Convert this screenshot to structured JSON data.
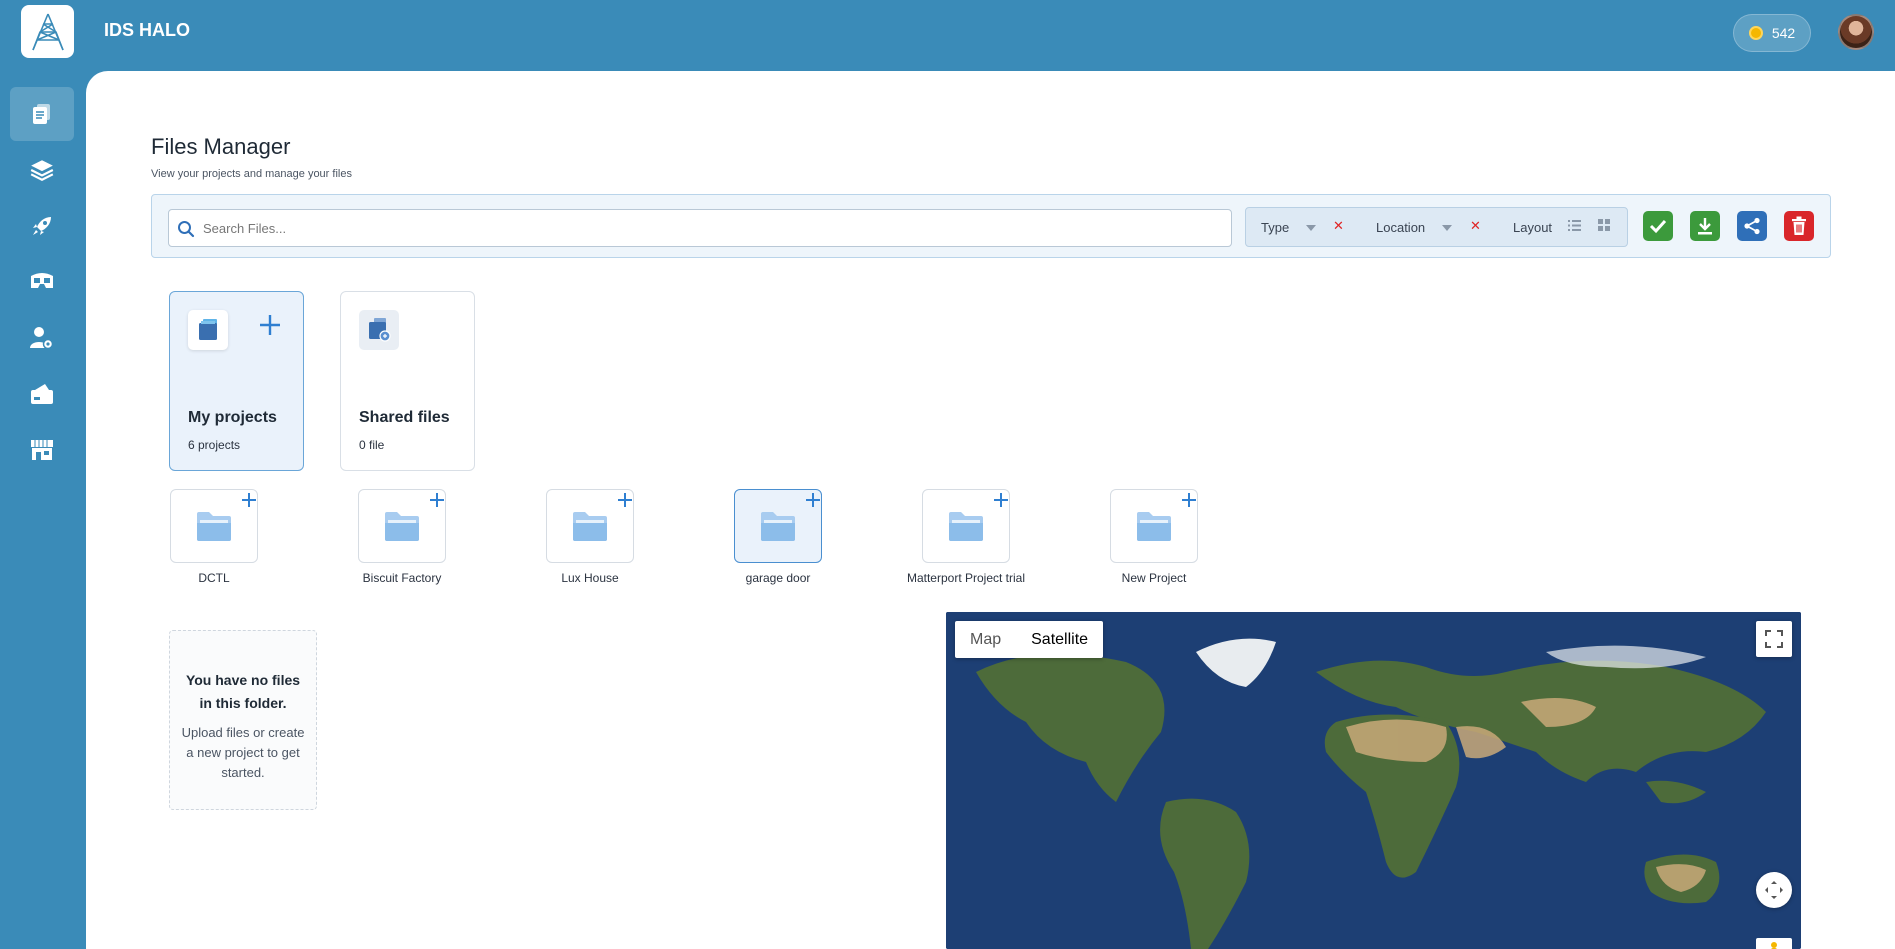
{
  "app": {
    "title": "IDS HALO",
    "credits": "542"
  },
  "sidebar": {
    "items": [
      {
        "name": "files",
        "icon": "files-icon",
        "active": true
      },
      {
        "name": "layers",
        "icon": "layers-icon"
      },
      {
        "name": "launch",
        "icon": "rocket-icon"
      },
      {
        "name": "viewer",
        "icon": "vr-headset-icon"
      },
      {
        "name": "user-settings",
        "icon": "user-gear-icon"
      },
      {
        "name": "billing",
        "icon": "card-icon"
      },
      {
        "name": "store",
        "icon": "store-icon"
      }
    ]
  },
  "page": {
    "title": "Files Manager",
    "subtitle": "View your projects and manage your files"
  },
  "toolbar": {
    "search_placeholder": "Search Files...",
    "filter_type": "Type",
    "filter_location": "Location",
    "layout_label": "Layout",
    "colors": {
      "confirm": "#3c9a3c",
      "download": "#3c9a3c",
      "share": "#2f6fb8",
      "delete": "#d9262a"
    }
  },
  "cards": [
    {
      "title": "My projects",
      "count": "6 projects",
      "selected": true
    },
    {
      "title": "Shared files",
      "count": "0 file",
      "selected": false
    }
  ],
  "folders": [
    {
      "label": "DCTL"
    },
    {
      "label": "Biscuit Factory"
    },
    {
      "label": "Lux House"
    },
    {
      "label": "garage door",
      "selected": true
    },
    {
      "label": "Matterport Project trial"
    },
    {
      "label": "New Project"
    }
  ],
  "empty": {
    "title": "You have no files in this folder.",
    "text": "Upload files or create a new project to get started."
  },
  "map": {
    "tab_map": "Map",
    "tab_satellite": "Satellite",
    "active_tab": "Satellite"
  }
}
